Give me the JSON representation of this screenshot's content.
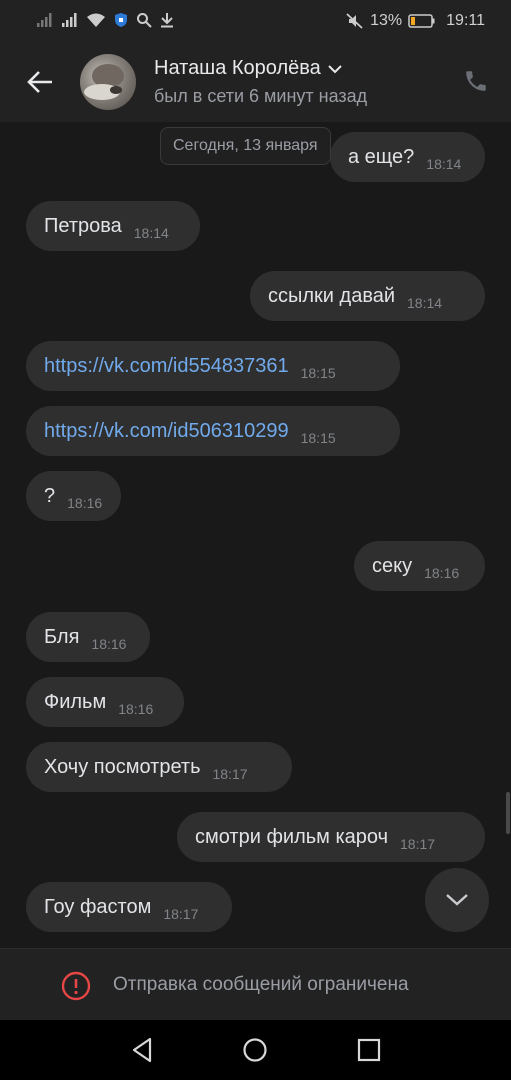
{
  "status_bar": {
    "battery_percent": "13%",
    "time": "19:11",
    "icons": [
      "signal-icon",
      "signal-icon",
      "wifi-icon",
      "vpn-shield-icon",
      "search-icon",
      "download-icon",
      "mute-icon",
      "battery-icon"
    ]
  },
  "header": {
    "name": "Наташа Королёва",
    "last_seen": "был в сети 6 минут назад"
  },
  "date_label": "Сегодня, 13 января",
  "messages": [
    {
      "side": "out",
      "text": "а еще?",
      "time": "18:14"
    },
    {
      "side": "in",
      "text": "Петрова",
      "time": "18:14"
    },
    {
      "side": "out",
      "text": "ссылки давай",
      "time": "18:14"
    },
    {
      "side": "in",
      "text": "https://vk.com/id554837361",
      "time": "18:15",
      "link": true
    },
    {
      "side": "in",
      "text": "https://vk.com/id506310299",
      "time": "18:15",
      "link": true
    },
    {
      "side": "in",
      "text": "?",
      "time": "18:16"
    },
    {
      "side": "out",
      "text": "секу",
      "time": "18:16"
    },
    {
      "side": "in",
      "text": "Бля",
      "time": "18:16"
    },
    {
      "side": "in",
      "text": "Фильм",
      "time": "18:16"
    },
    {
      "side": "in",
      "text": "Хочу посмотреть",
      "time": "18:17"
    },
    {
      "side": "out",
      "text": "смотри фильм кароч",
      "time": "18:17"
    },
    {
      "side": "in",
      "text": "Гоу фастом",
      "time": "18:17"
    }
  ],
  "restriction": {
    "text": "Отправка сообщений ограничена"
  },
  "colors": {
    "background": "#19191a",
    "bubble": "#2f2f30",
    "link": "#71aaeb",
    "warning": "#e64646",
    "battery": "#f5a623"
  }
}
